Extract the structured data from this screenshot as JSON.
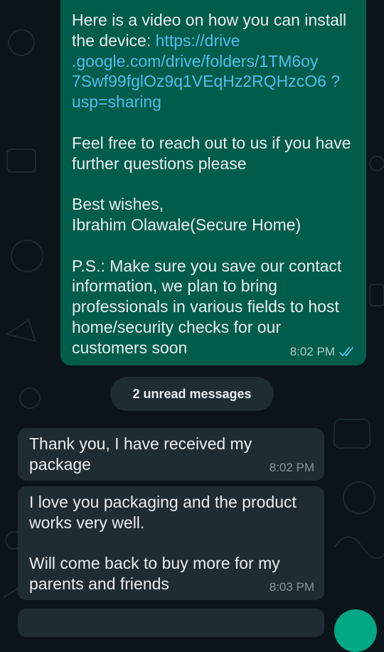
{
  "outgoing": {
    "intro_text": "Here is a video on how you can install the device: ",
    "link_text": "https://drive .google.com/drive/folders/1TM6oy 7Swf99fglOz9q1VEqHz2RQHzcO6 ?usp=sharing",
    "para_reach_out": "Feel free to reach out to us if you have further questions please",
    "signoff_line": "Best wishes,",
    "signoff_name": "Ibrahim Olawale(Secure Home)",
    "ps": "P.S.: Make sure you save our contact information, we plan to bring professionals in various fields to host home/security checks for our customers soon",
    "time": "8:02 PM",
    "status_icon": "double-check-read-icon",
    "link_color": "#53bdeb"
  },
  "unread_banner": "2 unread messages",
  "incoming": [
    {
      "paragraphs": [
        "Thank you, I have received my package"
      ],
      "time": "8:02 PM"
    },
    {
      "paragraphs": [
        "I love you packaging and the product works very well.",
        "Will come back to buy more for my parents and friends"
      ],
      "time": "8:03 PM"
    }
  ],
  "colors": {
    "background": "#0b141a",
    "outgoing_bubble": "#005c4b",
    "incoming_bubble": "#202c33",
    "accent": "#00a884"
  }
}
